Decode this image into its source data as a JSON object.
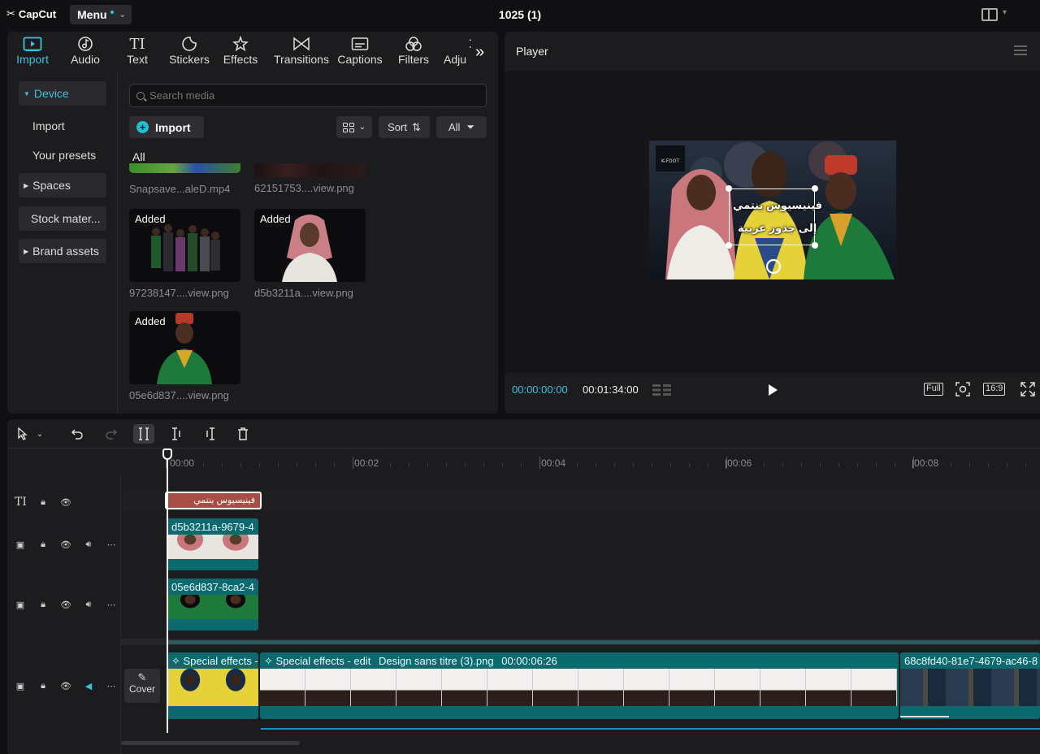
{
  "app": {
    "logo_text": "CapCut",
    "menu_label": "Menu",
    "project_title": "1025 (1)"
  },
  "tabs": [
    {
      "label": "Import",
      "icon": "import-icon",
      "active": true
    },
    {
      "label": "Audio",
      "icon": "audio-icon",
      "active": false
    },
    {
      "label": "Text",
      "icon": "text-icon",
      "active": false
    },
    {
      "label": "Stickers",
      "icon": "stickers-icon",
      "active": false
    },
    {
      "label": "Effects",
      "icon": "effects-icon",
      "active": false
    },
    {
      "label": "Transitions",
      "icon": "transitions-icon",
      "active": false
    },
    {
      "label": "Captions",
      "icon": "captions-icon",
      "active": false
    },
    {
      "label": "Filters",
      "icon": "filters-icon",
      "active": false
    },
    {
      "label": "Adju",
      "icon": "adjust-icon",
      "active": false
    }
  ],
  "sidebar": {
    "device": "Device",
    "import": "Import",
    "presets": "Your presets",
    "spaces": "Spaces",
    "stock": "Stock mater...",
    "brand": "Brand assets"
  },
  "media": {
    "search_placeholder": "Search media",
    "import_button": "Import",
    "sort_label": "Sort",
    "all_button": "All",
    "all_label": "All",
    "items": [
      {
        "badge": "",
        "name": "Snapsave...aleD.mp4"
      },
      {
        "badge": "",
        "name": "62151753....view.png"
      },
      {
        "badge": "Added",
        "name": "97238147....view.png"
      },
      {
        "badge": "Added",
        "name": "d5b3211a....view.png"
      },
      {
        "badge": "Added",
        "name": "05e6d837....view.png"
      }
    ]
  },
  "player": {
    "title": "Player",
    "caption_line1": "فينيسيوس ينتمي",
    "caption_line2": "إلى جذور عربية",
    "current_time": "00:00:00:00",
    "total_time": "00:01:34:00",
    "full_label": "Full",
    "ratio_label": "16:9"
  },
  "timeline": {
    "ruler": [
      "00:00",
      "|00:02",
      "|00:04",
      "|00:06",
      "|00:08"
    ],
    "text_clip": "فينيسيوس ينتمي",
    "clips": {
      "overlay1": "d5b3211a-9679-4",
      "overlay2": "05e6d837-8ca2-4",
      "main1": "Special effects -",
      "main2_effect": "Special effects - edit",
      "main2_name": "Design sans titre (3).png",
      "main2_duration": "00:00:06:26",
      "main3": "68c8fd40-81e7-4679-ac46-8"
    },
    "cover_label": "Cover"
  },
  "colors": {
    "accent": "#3bc3d8",
    "clip_teal": "#0c6a6e",
    "text_clip": "#a84d44"
  }
}
